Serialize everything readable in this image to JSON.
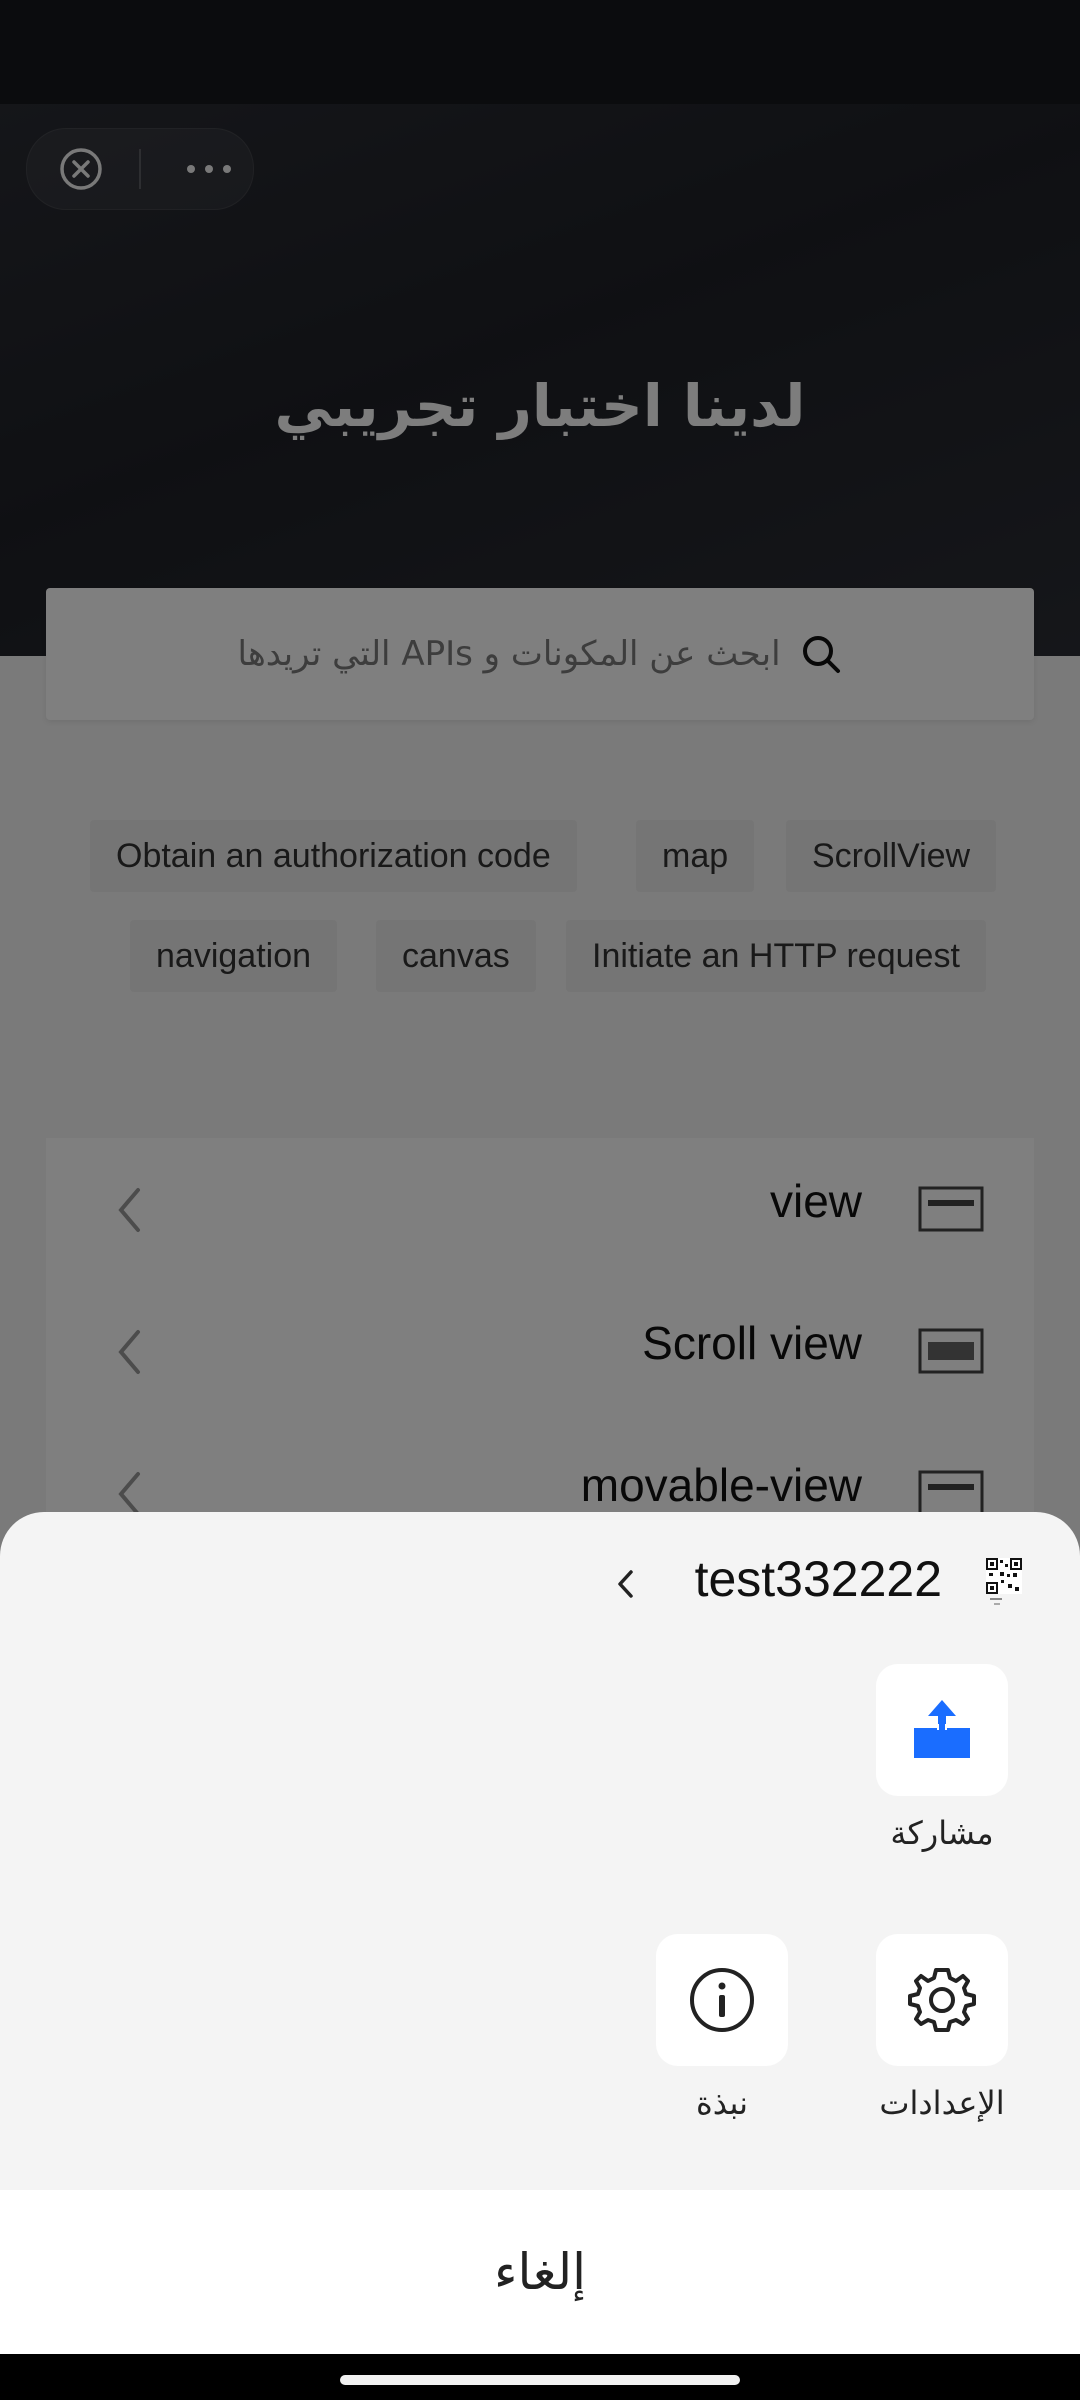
{
  "hero": {
    "title": "لدينا اختبار تجريبي"
  },
  "search": {
    "placeholder": "ابحث عن المكونات و APIs التي تريدها"
  },
  "chips": [
    "Obtain an authorization code",
    "map",
    "ScrollView",
    "navigation",
    "canvas",
    "Initiate an HTTP request"
  ],
  "list": [
    {
      "label": "view"
    },
    {
      "label": "Scroll view"
    },
    {
      "label": "movable-view"
    }
  ],
  "sheet": {
    "title": "test332222",
    "actions": {
      "share": "مشاركة",
      "settings": "الإعدادات",
      "about": "نبذة"
    },
    "cancel": "إلغاء"
  },
  "colors": {
    "accent": "#1a6dff",
    "dim": "#000000"
  },
  "icons": [
    "close-circle-icon",
    "more-dots-icon",
    "search-icon",
    "chevron-left-icon",
    "list-item-icon",
    "qr-code-icon",
    "share-upload-icon",
    "gear-icon",
    "info-icon"
  ]
}
